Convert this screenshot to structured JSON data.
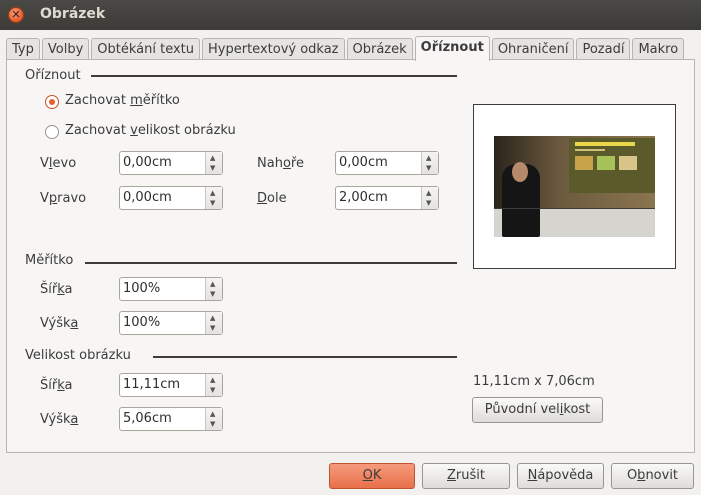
{
  "window": {
    "title": "Obrázek"
  },
  "tabs": [
    {
      "label": "Typ"
    },
    {
      "label": "Volby"
    },
    {
      "label": "Obtékání textu"
    },
    {
      "label": "Hypertextový odkaz"
    },
    {
      "label": "Obrázek"
    },
    {
      "label": "Oříznout",
      "active": true
    },
    {
      "label": "Ohraničení"
    },
    {
      "label": "Pozadí"
    },
    {
      "label": "Makro"
    }
  ],
  "crop": {
    "title": "Oříznout",
    "keep_scale": {
      "pre": "Zachovat ",
      "key": "m",
      "post": "ěřítko",
      "checked": true
    },
    "keep_size": {
      "pre": "Zachovat ",
      "key": "v",
      "post": "elikost obrázku",
      "checked": false
    },
    "left": {
      "pre": "V",
      "key": "l",
      "post": "evo",
      "value": "0,00cm"
    },
    "right": {
      "pre": "V",
      "key": "p",
      "post": "ravo",
      "value": "0,00cm"
    },
    "top": {
      "pre": "Nah",
      "key": "o",
      "post": "ře",
      "value": "0,00cm"
    },
    "bottom": {
      "pre": "",
      "key": "D",
      "post": "ole",
      "value": "2,00cm"
    }
  },
  "scale": {
    "title": "Měřítko",
    "width": {
      "pre": "Šíř",
      "key": "k",
      "post": "a",
      "value": "100%"
    },
    "height": {
      "pre": "Výšk",
      "key": "a",
      "post": "",
      "value": "100%"
    }
  },
  "image_size": {
    "title": "Velikost obrázku",
    "width": {
      "pre": "Šíř",
      "key": "k",
      "post": "a",
      "value": "11,11cm"
    },
    "height": {
      "pre": "Výšk",
      "key": "a",
      "post": "",
      "value": "5,06cm"
    }
  },
  "preview": {
    "size_text": "11,11cm x 7,06cm",
    "original_size_button": {
      "pre": "Původní vel",
      "key": "i",
      "post": "kost"
    }
  },
  "buttons": {
    "ok": {
      "pre": "",
      "key": "O",
      "post": "K"
    },
    "cancel": {
      "pre": "",
      "key": "Z",
      "post": "rušit"
    },
    "help": {
      "pre": "",
      "key": "N",
      "post": "ápověda"
    },
    "reset": {
      "pre": "O",
      "key": "b",
      "post": "novit"
    }
  }
}
